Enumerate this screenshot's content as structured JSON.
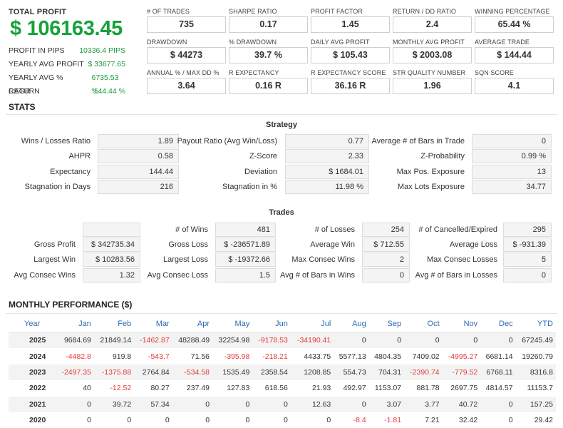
{
  "profit": {
    "label": "TOTAL PROFIT",
    "value": "$ 106163.45",
    "rows": [
      {
        "label": "PROFIT IN PIPS",
        "value": "10336.4 PIPS"
      },
      {
        "label": "YEARLY AVG PROFIT",
        "value": "$ 33677.65"
      },
      {
        "label": "YEARLY AVG % RETURN",
        "value": "6735.53 %"
      },
      {
        "label": "CAGR",
        "value": "144.44 %"
      }
    ]
  },
  "kpis": [
    {
      "label": "# OF TRADES",
      "value": "735"
    },
    {
      "label": "SHARPE RATIO",
      "value": "0.17"
    },
    {
      "label": "PROFIT FACTOR",
      "value": "1.45"
    },
    {
      "label": "RETURN / DD RATIO",
      "value": "2.4"
    },
    {
      "label": "WINNING PERCENTAGE",
      "value": "65.44 %"
    },
    {
      "label": "DRAWDOWN",
      "value": "$ 44273"
    },
    {
      "label": "% DRAWDOWN",
      "value": "39.7 %"
    },
    {
      "label": "DAILY AVG PROFIT",
      "value": "$ 105.43"
    },
    {
      "label": "MONTHLY AVG PROFIT",
      "value": "$ 2003.08"
    },
    {
      "label": "AVERAGE TRADE",
      "value": "$ 144.44"
    },
    {
      "label": "ANNUAL % / MAX DD %",
      "value": "3.64"
    },
    {
      "label": "R EXPECTANCY",
      "value": "0.16 R"
    },
    {
      "label": "R EXPECTANCY SCORE",
      "value": "36.16 R"
    },
    {
      "label": "STR QUALITY NUMBER",
      "value": "1.96"
    },
    {
      "label": "SQN SCORE",
      "value": "4.1"
    }
  ],
  "stats": {
    "title": "STATS",
    "strategy": {
      "title": "Strategy",
      "rows": [
        [
          {
            "label": "Wins / Losses Ratio",
            "value": "1.89"
          },
          {
            "label": "Payout Ratio (Avg Win/Loss)",
            "value": "0.77"
          },
          {
            "label": "Average # of Bars in Trade",
            "value": "0"
          }
        ],
        [
          {
            "label": "AHPR",
            "value": "0.58"
          },
          {
            "label": "Z-Score",
            "value": "2.33"
          },
          {
            "label": "Z-Probability",
            "value": "0.99 %"
          }
        ],
        [
          {
            "label": "Expectancy",
            "value": "144.44"
          },
          {
            "label": "Deviation",
            "value": "$ 1684.01"
          },
          {
            "label": "Max Pos. Exposure",
            "value": "13"
          }
        ],
        [
          {
            "label": "Stagnation in Days",
            "value": "216"
          },
          {
            "label": "Stagnation in %",
            "value": "11.98 %"
          },
          {
            "label": "Max Lots Exposure",
            "value": "34.77"
          }
        ]
      ]
    },
    "trades": {
      "title": "Trades",
      "rows": [
        [
          {
            "label": "",
            "value": ""
          },
          {
            "label": "# of Wins",
            "value": "481"
          },
          {
            "label": "# of Losses",
            "value": "254"
          },
          {
            "label": "# of Cancelled/Expired",
            "value": "295"
          }
        ],
        [
          {
            "label": "Gross Profit",
            "value": "$ 342735.34"
          },
          {
            "label": "Gross Loss",
            "value": "$ -236571.89"
          },
          {
            "label": "Average Win",
            "value": "$ 712.55"
          },
          {
            "label": "Average Loss",
            "value": "$ -931.39"
          }
        ],
        [
          {
            "label": "Largest Win",
            "value": "$ 10283.56"
          },
          {
            "label": "Largest Loss",
            "value": "$ -19372.66"
          },
          {
            "label": "Max Consec Wins",
            "value": "2"
          },
          {
            "label": "Max Consec Losses",
            "value": "5"
          }
        ],
        [
          {
            "label": "Avg Consec Wins",
            "value": "1.32"
          },
          {
            "label": "Avg Consec Loss",
            "value": "1.5"
          },
          {
            "label": "Avg # of Bars in Wins",
            "value": "0"
          },
          {
            "label": "Avg # of Bars in Losses",
            "value": "0"
          }
        ]
      ]
    }
  },
  "monthly": {
    "title": "MONTHLY PERFORMANCE ($)",
    "headers": [
      "Year",
      "Jan",
      "Feb",
      "Mar",
      "Apr",
      "May",
      "Jun",
      "Jul",
      "Aug",
      "Sep",
      "Oct",
      "Nov",
      "Dec",
      "YTD"
    ],
    "rows": [
      [
        "2025",
        "9684.69",
        "21849.14",
        "-1462.87",
        "48288.49",
        "32254.98",
        "-9178.53",
        "-34190.41",
        "0",
        "0",
        "0",
        "0",
        "0",
        "67245.49"
      ],
      [
        "2024",
        "-4482.8",
        "919.8",
        "-543.7",
        "71.56",
        "-395.98",
        "-218.21",
        "4433.75",
        "5577.13",
        "4804.35",
        "7409.02",
        "-4995.27",
        "6681.14",
        "19260.79"
      ],
      [
        "2023",
        "-2497.35",
        "-1375.88",
        "2764.84",
        "-534.58",
        "1535.49",
        "2358.54",
        "1208.85",
        "554.73",
        "704.31",
        "-2390.74",
        "-779.52",
        "6768.11",
        "8316.8"
      ],
      [
        "2022",
        "40",
        "-12.52",
        "80.27",
        "237.49",
        "127.83",
        "618.56",
        "21.93",
        "492.97",
        "1153.07",
        "881.78",
        "2697.75",
        "4814.57",
        "11153.7"
      ],
      [
        "2021",
        "0",
        "39.72",
        "57.34",
        "0",
        "0",
        "0",
        "12.63",
        "0",
        "3.07",
        "3.77",
        "40.72",
        "0",
        "157.25"
      ],
      [
        "2020",
        "0",
        "0",
        "0",
        "0",
        "0",
        "0",
        "0",
        "-8.4",
        "-1.81",
        "7.21",
        "32.42",
        "0",
        "29.42"
      ]
    ]
  },
  "colors": {
    "profit_green": "#14a23a",
    "negative_red": "#e23b3b",
    "header_blue": "#2a6bb0"
  }
}
